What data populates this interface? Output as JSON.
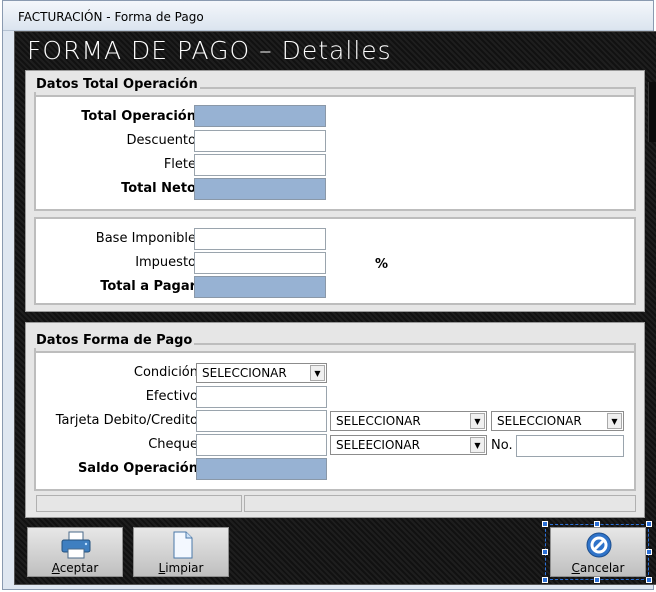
{
  "window": {
    "title": "FACTURACIÓN  -  Forma de Pago"
  },
  "header": {
    "title": "FORMA DE PAGO  –  Detalles"
  },
  "totales": {
    "legend": "Datos Total Operación",
    "total_operacion_label": "Total Operación",
    "descuento_label": "Descuento",
    "flete_label": "Flete",
    "total_neto_label": "Total Neto",
    "base_imponible_label": "Base Imponible",
    "impuesto_label": "Impuesto",
    "percent_symbol": "%",
    "total_pagar_label": "Total a Pagar"
  },
  "forma_pago": {
    "legend": "Datos Forma de Pago",
    "condicion_label": "Condición",
    "condicion_value": "SELECCIONAR",
    "efectivo_label": "Efectivo",
    "tarjeta_label": "Tarjeta Debito/Credito",
    "tarjeta_select1": "SELECCIONAR",
    "tarjeta_select2": "SELECCIONAR",
    "cheque_label": "Cheque",
    "cheque_select": "SELEECIONAR",
    "no_label": "No.",
    "saldo_label": "Saldo Operación"
  },
  "buttons": {
    "aceptar_mnemonic": "A",
    "aceptar_rest": "ceptar",
    "limpiar_mnemonic": "L",
    "limpiar_rest": "impiar",
    "cancelar_mnemonic": "C",
    "cancelar_rest": "ancelar"
  },
  "colors": {
    "readonly_field": "#97b2d3",
    "background": "#141414"
  },
  "icons": {
    "aceptar": "printer-icon",
    "limpiar": "blank-document-icon",
    "cancelar": "cancel-icon"
  }
}
